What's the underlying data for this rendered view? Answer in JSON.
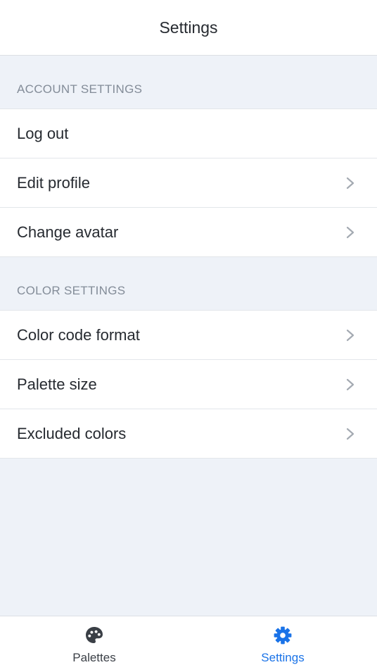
{
  "header": {
    "title": "Settings"
  },
  "sections": [
    {
      "title": "ACCOUNT SETTINGS",
      "items": [
        {
          "label": "Log out",
          "chevron": false
        },
        {
          "label": "Edit profile",
          "chevron": true
        },
        {
          "label": "Change avatar",
          "chevron": true
        }
      ]
    },
    {
      "title": "COLOR SETTINGS",
      "items": [
        {
          "label": "Color code format",
          "chevron": true
        },
        {
          "label": "Palette size",
          "chevron": true
        },
        {
          "label": "Excluded colors",
          "chevron": true
        }
      ]
    }
  ],
  "tabbar": {
    "tabs": [
      {
        "label": "Palettes",
        "icon": "palette-icon",
        "active": false
      },
      {
        "label": "Settings",
        "icon": "gear-icon",
        "active": true
      }
    ]
  },
  "colors": {
    "accent": "#1a73e8",
    "inactive_tab": "#3a3f46",
    "background": "#eef2f8",
    "chevron": "#a4aab2",
    "section_title": "#838c98"
  }
}
